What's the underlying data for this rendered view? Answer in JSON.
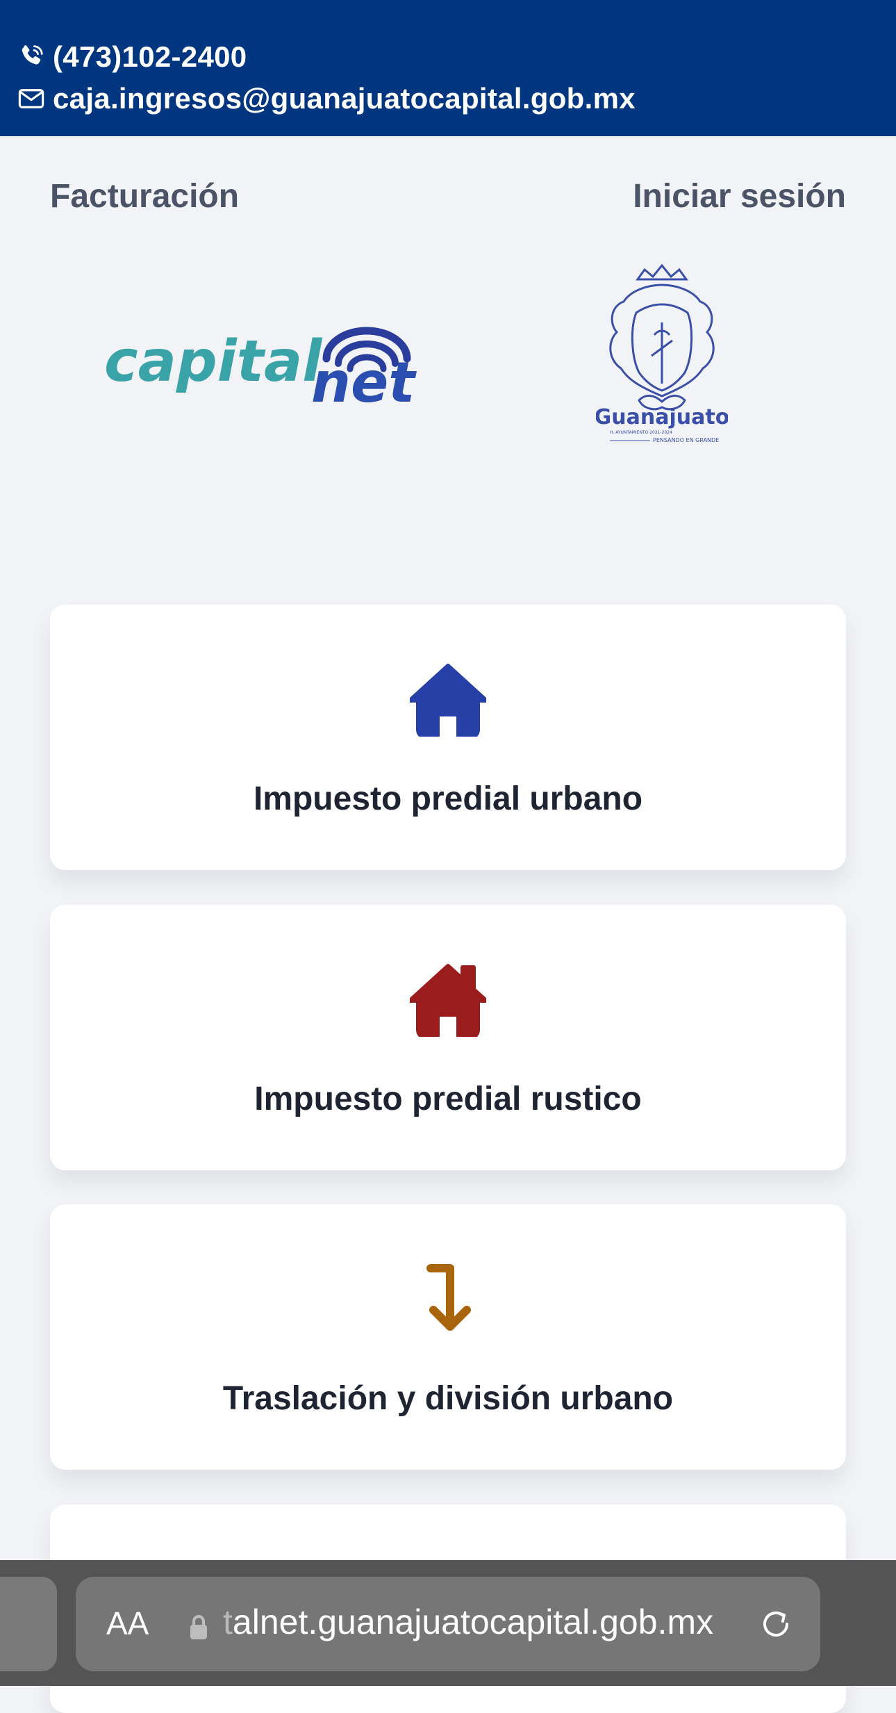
{
  "contact": {
    "phone": "(473)102-2400",
    "email": "caja.ingresos@guanajuatocapital.gob.mx"
  },
  "nav": {
    "billing": "Facturación",
    "login": "Iniciar sesión"
  },
  "logos": {
    "capital_word": "capital",
    "net_word": "net",
    "city_name": "Guanajuato",
    "city_small_line": "H. AYUNTAMIENTO 2021-2024",
    "city_tagline": "PENSANDO EN GRANDE"
  },
  "services": [
    {
      "label": "Impuesto predial urbano",
      "icon": "house-icon",
      "color": "#2740a8"
    },
    {
      "label": "Impuesto predial rustico",
      "icon": "house-chimney-icon",
      "color": "#9b1c1c"
    },
    {
      "label": "Traslación y división urbano",
      "icon": "arrow-turn-down-icon",
      "color": "#a8650c"
    }
  ],
  "browser": {
    "text_size_button": "AA",
    "url_faded": "t",
    "url": "alnet.guanajuatocapital.gob.mx"
  },
  "colors": {
    "header_bg": "#003580",
    "page_bg": "#f2f3f6",
    "brand_teal": "#3aa3a8",
    "brand_blue": "#2a4fb0"
  }
}
